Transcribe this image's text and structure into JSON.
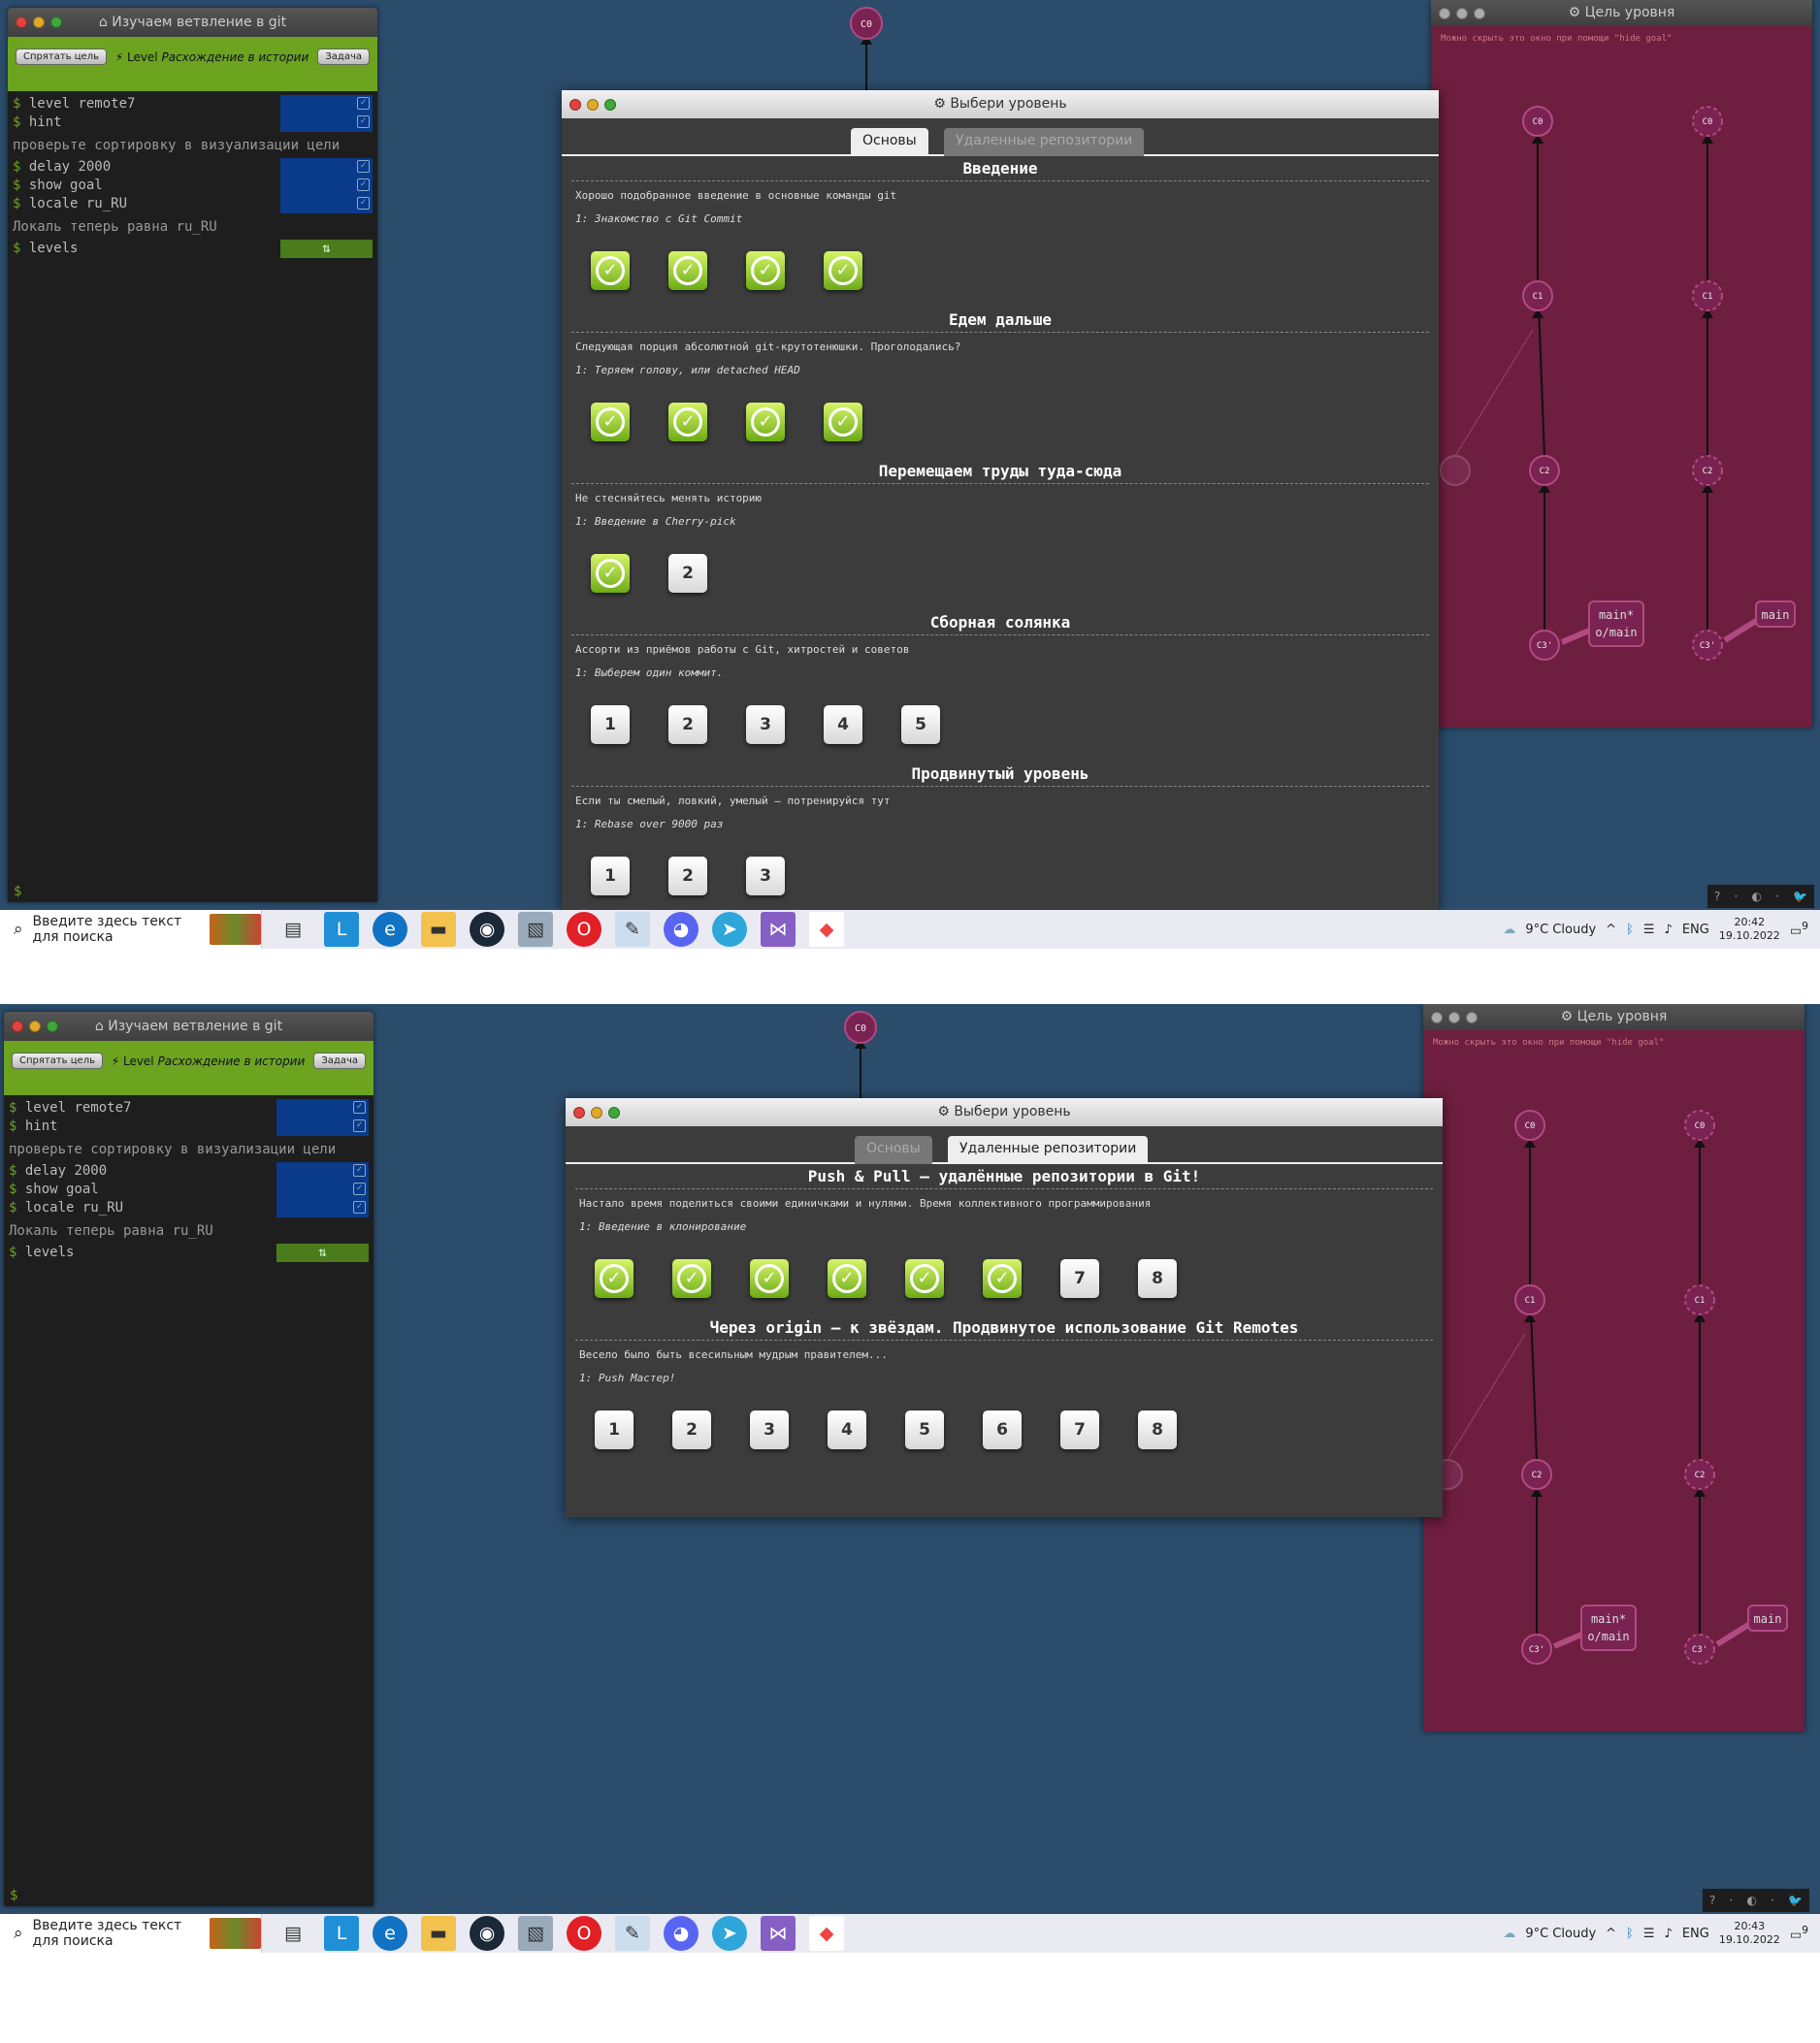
{
  "terminal": {
    "title": "Изучаем ветвление в git",
    "hide_goal_label": "Спрятать цель",
    "task_label": "Задача",
    "level_prefix": "Level",
    "level_name": "Расхождение в истории",
    "lines1": [
      "level remote7",
      "hint"
    ],
    "note1": "проверьте сортировку в визуализации цели",
    "lines2": [
      "delay 2000",
      "show goal",
      "locale ru_RU"
    ],
    "note2": "Локаль теперь равна ru_RU",
    "levels_cmd": "levels",
    "dollar": "$"
  },
  "goal": {
    "title": "Цель уровня",
    "hint": "Можно скрыть это окно при помощи \"hide goal\"",
    "nodes": [
      "C0",
      "C1",
      "C2",
      "C3'"
    ],
    "left_label1": "main*",
    "left_label2": "o/main",
    "right_label": "main"
  },
  "canvas_node": "C0",
  "dialog": {
    "title": "Выбери уровень",
    "tab_basics": "Основы",
    "tab_remote": "Удаленные репозитории"
  },
  "basics": [
    {
      "title": "Введение",
      "desc": "Хорошо подобранное введение в основные команды git",
      "sub": "1: Знакомство с Git Commit",
      "levels": [
        true,
        true,
        true,
        true
      ]
    },
    {
      "title": "Едем дальше",
      "desc": "Следующая порция абсолютной git-крутотенюшки. Проголодались?",
      "sub": "1: Теряем голову, или detached HEAD",
      "levels": [
        true,
        true,
        true,
        true
      ]
    },
    {
      "title": "Перемещаем труды туда-сюда",
      "desc": "Не стесняйтесь менять историю",
      "sub": "1: Введение в Cherry-pick",
      "levels": [
        true,
        "2"
      ]
    },
    {
      "title": "Сборная солянка",
      "desc": "Ассорти из приёмов работы с Git, хитростей и советов",
      "sub": "1: Выберем один коммит.",
      "levels": [
        "1",
        "2",
        "3",
        "4",
        "5"
      ]
    },
    {
      "title": "Продвинутый уровень",
      "desc": "Если ты смелый, ловкий, умелый – потренируйся тут",
      "sub": "1: Rebase over 9000 раз",
      "levels": [
        "1",
        "2",
        "3"
      ]
    }
  ],
  "remote": [
    {
      "title": "Push & Pull – удалённые репозитории в Git!",
      "desc": "Настало время поделиться своими единичками и нулями. Время коллективного программирования",
      "sub": "1: Введение в клонирование",
      "levels": [
        true,
        true,
        true,
        true,
        true,
        true,
        "7",
        "8"
      ]
    },
    {
      "title": "Через origin – к звёздам. Продвинутое использование Git Remotes",
      "desc": "Весело было быть всесильным мудрым правителем...",
      "sub": "1: Push Мастер!",
      "levels": [
        "1",
        "2",
        "3",
        "4",
        "5",
        "6",
        "7",
        "8"
      ]
    }
  ],
  "taskbar": {
    "search_placeholder": "Введите здесь текст для поиска",
    "weather": "9°C  Cloudy",
    "lang": "ENG",
    "time_top": "20:42",
    "time_bottom": "20:43",
    "date": "19.10.2022",
    "notif_count": "9"
  },
  "mini_bar": [
    "?",
    "·",
    "◐",
    "·",
    "🐦"
  ]
}
